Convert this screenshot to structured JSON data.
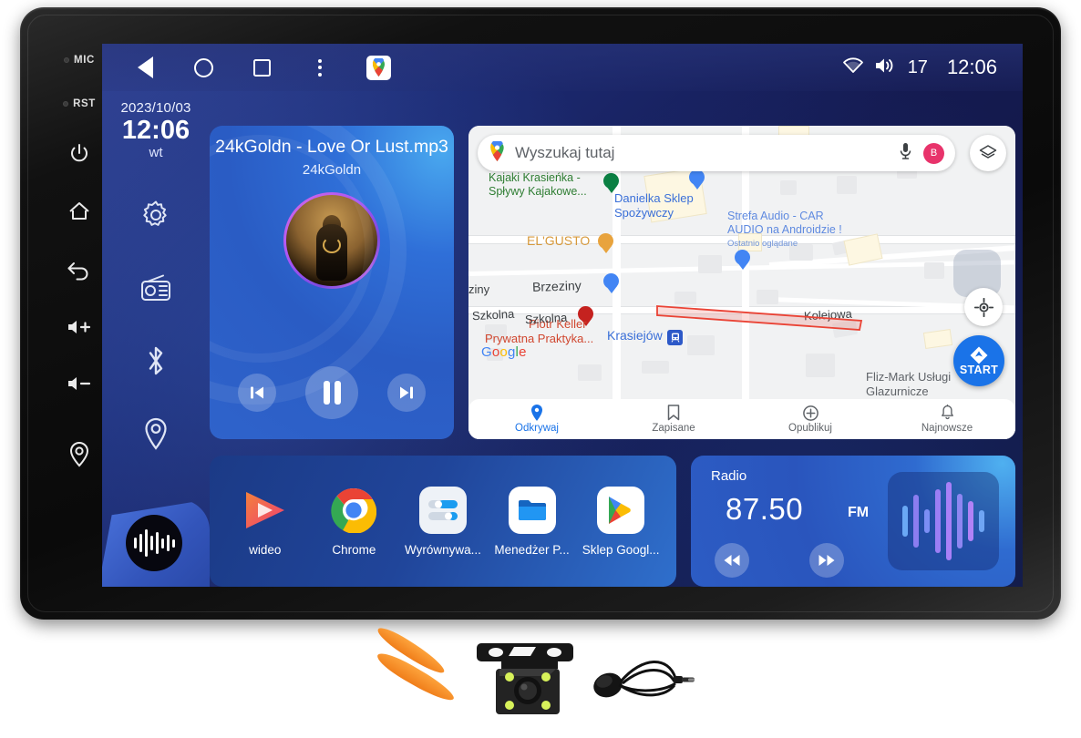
{
  "device": {
    "hardware_buttons": [
      {
        "name": "mic",
        "label": "MIC"
      },
      {
        "name": "reset",
        "label": "RST"
      },
      {
        "name": "power",
        "label": ""
      },
      {
        "name": "home",
        "label": ""
      },
      {
        "name": "back",
        "label": ""
      },
      {
        "name": "volume-up",
        "label": ""
      },
      {
        "name": "volume-down",
        "label": ""
      },
      {
        "name": "location",
        "label": ""
      }
    ]
  },
  "statusbar": {
    "nav": {
      "back": "back-icon",
      "home": "home-icon",
      "recents": "recents-icon",
      "overflow": "more-vert-icon",
      "maps_shortcut": "google-maps-icon"
    },
    "wifi": "wifi-icon",
    "volume_icon": "volume-icon",
    "volume_level": "17",
    "clock": "12:06"
  },
  "sidebar": {
    "date": "2023/10/03",
    "time": "12:06",
    "weekday": "wt",
    "items": [
      {
        "label": "settings",
        "icon": "gear-icon"
      },
      {
        "label": "radio",
        "icon": "radio-icon"
      },
      {
        "label": "bluetooth",
        "icon": "bluetooth-icon"
      },
      {
        "label": "navigation",
        "icon": "location-pin-icon"
      }
    ],
    "music_button": "music-waveform-icon"
  },
  "music": {
    "title": "24kGoldn - Love Or Lust.mp3",
    "artist": "24kGoldn",
    "album_art": "album-art",
    "controls": {
      "previous": "skip-previous-icon",
      "play_pause": "pause-icon",
      "next": "skip-next-icon"
    }
  },
  "map": {
    "search": {
      "placeholder": "Wyszukaj tutaj",
      "leading_icon": "google-maps-pin-icon",
      "mic_icon": "microphone-icon",
      "avatar_initial": "B"
    },
    "layers_button": "layers-icon",
    "locate_button": "my-location-icon",
    "start_button": {
      "label": "START",
      "icon": "navigation-arrow-icon"
    },
    "attribution": "Google",
    "pois": [
      {
        "name": "Kajaki Krasieńka - Spływy Kajakowe...",
        "color": "#2e7d32",
        "lines": [
          "Kajaki Krasieńka -",
          "Spływy Kajakowe..."
        ]
      },
      {
        "name": "Danielka Sklep Spożywczy",
        "color": "#3a6fd8",
        "lines": [
          "Danielka Sklep",
          "Spożywczy"
        ]
      },
      {
        "name": "Strefa Audio - CAR AUDIO na Androidzie !",
        "color": "#5f8ae0",
        "lines": [
          "Strefa Audio - CAR",
          "AUDIO na Androidzie !"
        ],
        "sub": "Ostatnio oglądane"
      },
      {
        "name": "EL'GUSTO",
        "color": "#d79a3c",
        "lines": [
          "EL'GUSTO"
        ]
      },
      {
        "name": "Piotr Keller Prywatna Praktyka...",
        "color": "#d0472f",
        "lines": [
          "Piotr Keller",
          "Prywatna Praktyka..."
        ]
      },
      {
        "name": "Fliz-Mark Usługi Glazurnicze",
        "color": "#5f6368",
        "lines": [
          "Fliz-Mark Usługi",
          "Glazurnicze"
        ]
      }
    ],
    "street_labels": [
      "ziny",
      "Brzeziny",
      "Szkolna",
      "Szkolna",
      "Kolejowa"
    ],
    "station_label": "Krasiejów",
    "bottom_nav": [
      {
        "label": "Odkrywaj",
        "icon": "explore-pin-icon",
        "active": true
      },
      {
        "label": "Zapisane",
        "icon": "bookmark-icon",
        "active": false
      },
      {
        "label": "Opublikuj",
        "icon": "plus-circle-icon",
        "active": false
      },
      {
        "label": "Najnowsze",
        "icon": "bell-icon",
        "active": false
      }
    ]
  },
  "apps": [
    {
      "label": "wideo",
      "icon": "video-player-icon"
    },
    {
      "label": "Chrome",
      "icon": "chrome-icon"
    },
    {
      "label": "Wyrównywa...",
      "icon": "equalizer-icon"
    },
    {
      "label": "Menedżer P...",
      "icon": "file-manager-icon"
    },
    {
      "label": "Sklep Googl...",
      "icon": "google-play-icon"
    }
  ],
  "radio": {
    "title": "Radio",
    "frequency": "87.50",
    "band": "FM",
    "prev_icon": "rewind-icon",
    "next_icon": "fast-forward-icon",
    "visualizer": "audio-waveform-icon"
  },
  "accessories": [
    {
      "name": "pry-tools",
      "label": ""
    },
    {
      "name": "backup-camera",
      "label": ""
    },
    {
      "name": "external-microphone",
      "label": ""
    }
  ],
  "colors": {
    "screen_bg": "#1c2a72",
    "card_blue": "#2a5cc4",
    "accent_blue": "#1a73e8",
    "avatar_pink": "#e8336b"
  }
}
